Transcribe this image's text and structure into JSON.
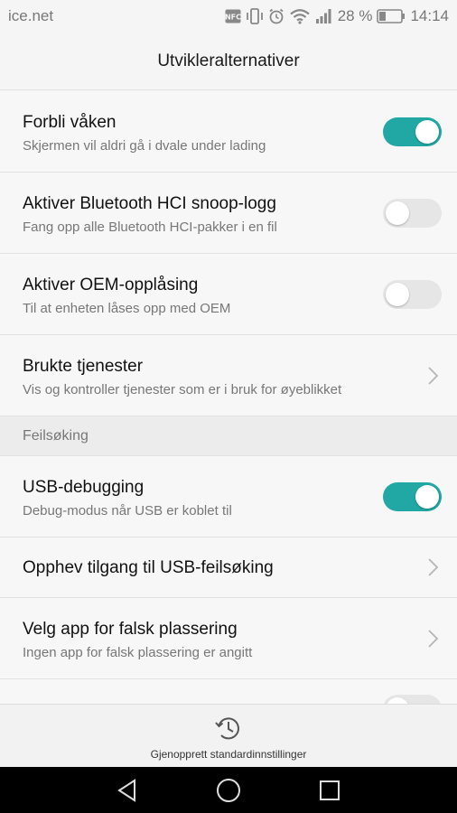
{
  "status_bar": {
    "carrier": "ice.net",
    "battery": "28 %",
    "time": "14:14",
    "icons": [
      "nfc-icon",
      "vibrate-icon",
      "alarm-icon",
      "wifi-icon",
      "signal-icon",
      "battery-icon"
    ]
  },
  "header": {
    "title": "Utvikleralternativer"
  },
  "items": [
    {
      "title": "Forbli våken",
      "subtitle": "Skjermen vil aldri gå i dvale under lading",
      "toggle": true
    },
    {
      "title": "Aktiver Bluetooth HCI snoop-logg",
      "subtitle": "Fang opp alle Bluetooth HCI-pakker i en fil",
      "toggle": false
    },
    {
      "title": "Aktiver OEM-opplåsing",
      "subtitle": "Til at enheten låses opp med OEM",
      "toggle": false
    },
    {
      "title": "Brukte tjenester",
      "subtitle": "Vis og kontroller tjenester som er i bruk for øyeblikket"
    }
  ],
  "section": {
    "title": "Feilsøking"
  },
  "debug_items": [
    {
      "title": "USB-debugging",
      "subtitle": "Debug-modus når USB er koblet til",
      "toggle": true
    },
    {
      "title": "Opphev tilgang til USB-feilsøking"
    },
    {
      "title": "Velg app for falsk plassering",
      "subtitle": "Ingen app for falsk plassering er angitt"
    }
  ],
  "bottom_action": {
    "label": "Gjenopprett standardinnstillinger",
    "icon": "history-restore-icon"
  },
  "navigation": {
    "icons": [
      "back-icon",
      "home-icon",
      "recents-icon"
    ]
  },
  "colors": {
    "accent": "#21a8a4",
    "toggle_off": "#e6e6e6",
    "nav_bar": "#000000"
  }
}
